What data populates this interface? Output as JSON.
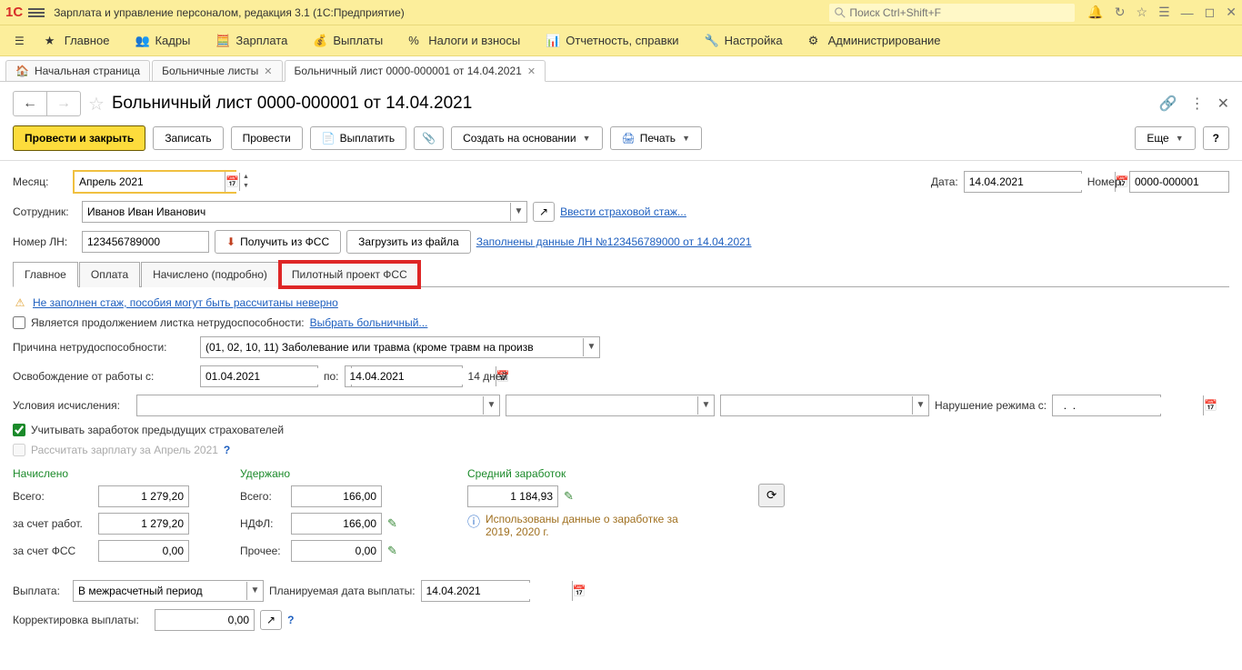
{
  "titlebar": {
    "app_title": "Зарплата и управление персоналом, редакция 3.1  (1С:Предприятие)",
    "search_placeholder": "Поиск Ctrl+Shift+F"
  },
  "mainmenu": {
    "home": "Главное",
    "kadry": "Кадры",
    "zarplata": "Зарплата",
    "vyplaty": "Выплаты",
    "nalogi": "Налоги и взносы",
    "otchet": "Отчетность, справки",
    "nastroika": "Настройка",
    "admin": "Администрирование"
  },
  "navtabs": {
    "start": "Начальная страница",
    "list": "Больничные листы",
    "doc": "Больничный лист 0000-000001 от 14.04.2021"
  },
  "doc_title": "Больничный лист 0000-000001 от 14.04.2021",
  "toolbar": {
    "post_close": "Провести и закрыть",
    "save": "Записать",
    "post": "Провести",
    "pay": "Выплатить",
    "create_based": "Создать на основании",
    "print": "Печать",
    "more": "Еще"
  },
  "form": {
    "month_lbl": "Месяц:",
    "month_val": "Апрель 2021",
    "date_lbl": "Дата:",
    "date_val": "14.04.2021",
    "number_lbl": "Номер:",
    "number_val": "0000-000001",
    "employee_lbl": "Сотрудник:",
    "employee_val": "Иванов Иван Иванович",
    "stazh_link": "Ввести страховой стаж...",
    "ln_lbl": "Номер ЛН:",
    "ln_val": "123456789000",
    "get_fss": "Получить из ФСС",
    "load_file": "Загрузить из файла",
    "ln_link": "Заполнены данные ЛН №123456789000 от 14.04.2021"
  },
  "subtabs": {
    "main": "Главное",
    "payment": "Оплата",
    "accrued": "Начислено (подробно)",
    "pilot": "Пилотный проект ФСС"
  },
  "main_tab": {
    "warn_link": "Не заполнен стаж, пособия могут быть рассчитаны неверно",
    "continuation_lbl": "Является продолжением листка нетрудоспособности:",
    "choose_ln": "Выбрать больничный...",
    "reason_lbl": "Причина нетрудоспособности:",
    "reason_val": "(01, 02, 10, 11) Заболевание или травма (кроме травм на произв",
    "off_from_lbl": "Освобождение от работы с:",
    "off_from": "01.04.2021",
    "off_to_lbl": "по:",
    "off_to": "14.04.2021",
    "days": "14 дней",
    "conditions_lbl": "Условия исчисления:",
    "violation_lbl": "Нарушение режима с:",
    "violation_val": "  .  .    ",
    "consider_lbl": "Учитывать заработок предыдущих страхователей",
    "recalc_lbl": "Рассчитать зарплату за Апрель 2021"
  },
  "totals": {
    "accrued_hdr": "Начислено",
    "withheld_hdr": "Удержано",
    "avg_hdr": "Средний заработок",
    "total_lbl": "Всего:",
    "accrued_total": "1 279,20",
    "withheld_total": "166,00",
    "avg_val": "1 184,93",
    "employer_lbl": "за счет работ.",
    "employer_val": "1 279,20",
    "ndfl_lbl": "НДФЛ:",
    "ndfl_val": "166,00",
    "fss_lbl": "за счет ФСС",
    "fss_val": "0,00",
    "other_lbl": "Прочее:",
    "other_val": "0,00",
    "info_text": "Использованы данные о заработке за 2019,  2020 г."
  },
  "bottom": {
    "payout_lbl": "Выплата:",
    "payout_val": "В межрасчетный период",
    "plan_date_lbl": "Планируемая дата выплаты:",
    "plan_date_val": "14.04.2021",
    "korr_lbl": "Корректировка выплаты:",
    "korr_val": "0,00"
  }
}
